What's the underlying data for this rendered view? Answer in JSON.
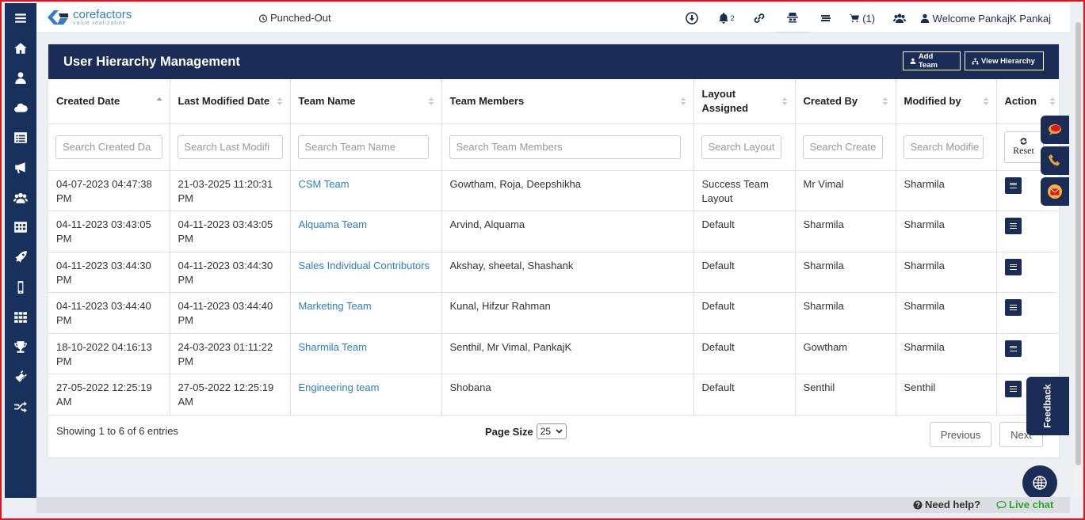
{
  "app": {
    "logo_name": "corefactors",
    "logo_tagline": "value realization",
    "punch_status": "Punched-Out",
    "notification_count": "2",
    "cart_count": "(1)",
    "welcome": "Welcome PankajK Pankaj"
  },
  "sidebar": {
    "items": [
      {
        "icon": "menu-icon"
      },
      {
        "icon": "home-icon"
      },
      {
        "icon": "user-icon"
      },
      {
        "icon": "cloud-icon"
      },
      {
        "icon": "list-icon"
      },
      {
        "icon": "megaphone-icon"
      },
      {
        "icon": "users-icon"
      },
      {
        "icon": "table-icon"
      },
      {
        "icon": "rocket-icon"
      },
      {
        "icon": "mobile-icon"
      },
      {
        "icon": "grid-icon"
      },
      {
        "icon": "trophy-icon"
      },
      {
        "icon": "ticket-icon"
      },
      {
        "icon": "shuffle-icon"
      }
    ]
  },
  "panel": {
    "title": "User Hierarchy Management",
    "add_team": "Add Team",
    "view_hierarchy": "View Hierarchy"
  },
  "table": {
    "columns": [
      "Created Date",
      "Last Modified Date",
      "Team Name",
      "Team Members",
      "Layout Assigned",
      "Created By",
      "Modified by",
      "Action"
    ],
    "placeholders": [
      "Search Created Da",
      "Search Last Modifi",
      "Search Team Name",
      "Search Team Members",
      "Search Layout",
      "Search Create",
      "Search Modifie"
    ],
    "reset_label": "Reset",
    "rows": [
      {
        "created": "04-07-2023 04:47:38 PM",
        "modified": "21-03-2025 11:20:31 PM",
        "team": "CSM Team",
        "members": "Gowtham, Roja, Deepshikha",
        "layout": "Success Team Layout",
        "created_by": "Mr Vimal",
        "modified_by": "Sharmila"
      },
      {
        "created": "04-11-2023 03:43:05 PM",
        "modified": "04-11-2023 03:43:05 PM",
        "team": "Alquama Team",
        "members": "Arvind, Alquama",
        "layout": "Default",
        "created_by": "Sharmila",
        "modified_by": "Sharmila"
      },
      {
        "created": "04-11-2023 03:44:30 PM",
        "modified": "04-11-2023 03:44:30 PM",
        "team": "Sales Individual Contributors",
        "members": "Akshay, sheetal, Shashank",
        "layout": "Default",
        "created_by": "Sharmila",
        "modified_by": "Sharmila"
      },
      {
        "created": "04-11-2023 03:44:40 PM",
        "modified": "04-11-2023 03:44:40 PM",
        "team": "Marketing Team",
        "members": "Kunal, Hifzur Rahman",
        "layout": "Default",
        "created_by": "Sharmila",
        "modified_by": "Sharmila"
      },
      {
        "created": "18-10-2022 04:16:13 PM",
        "modified": "24-03-2023 01:11:22 PM",
        "team": "Sharmila Team",
        "members": "Senthil, Mr Vimal, PankajK",
        "layout": "Default",
        "created_by": "Gowtham",
        "modified_by": "Sharmila"
      },
      {
        "created": "27-05-2022 12:25:19 AM",
        "modified": "27-05-2022 12:25:19 AM",
        "team": "Engineering team",
        "members": "Shobana",
        "layout": "Default",
        "created_by": "Senthil",
        "modified_by": "Senthil"
      }
    ]
  },
  "footer": {
    "showing": "Showing 1 to 6 of 6 entries",
    "page_size_label": "Page Size",
    "page_size_value": "25",
    "previous": "Previous",
    "next": "Next"
  },
  "widgets": {
    "feedback": "Feedback",
    "need_help": "Need help?",
    "live_chat": "Live chat"
  },
  "colors": {
    "navy": "#1b2d57",
    "link": "#2f7ec9",
    "live_chat": "#2aa52a",
    "border_frame": "#e0141e"
  }
}
